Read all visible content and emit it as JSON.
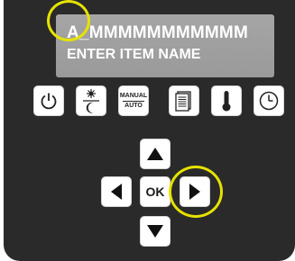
{
  "display": {
    "line1": "A_MMMMMMMMMMM",
    "line2": "ENTER ITEM NAME"
  },
  "function_keys": [
    {
      "name": "power",
      "icon": "power-icon"
    },
    {
      "name": "day-night",
      "icon": "sun-moon-icon"
    },
    {
      "name": "manual-auto",
      "icon": "manual-auto-label",
      "top_label": "MANUAL",
      "bottom_label": "AUTO"
    },
    {
      "name": "menu",
      "icon": "document-list-icon"
    },
    {
      "name": "temperature",
      "icon": "thermometer-icon"
    },
    {
      "name": "clock",
      "icon": "clock-icon"
    }
  ],
  "navigation": {
    "ok_label": "OK",
    "icons": [
      "up-arrow-icon",
      "left-arrow-icon",
      "right-arrow-icon",
      "down-arrow-icon"
    ]
  },
  "highlights": {
    "color": "#e6e200",
    "targets": [
      "display-first-character",
      "right-arrow-button"
    ]
  }
}
